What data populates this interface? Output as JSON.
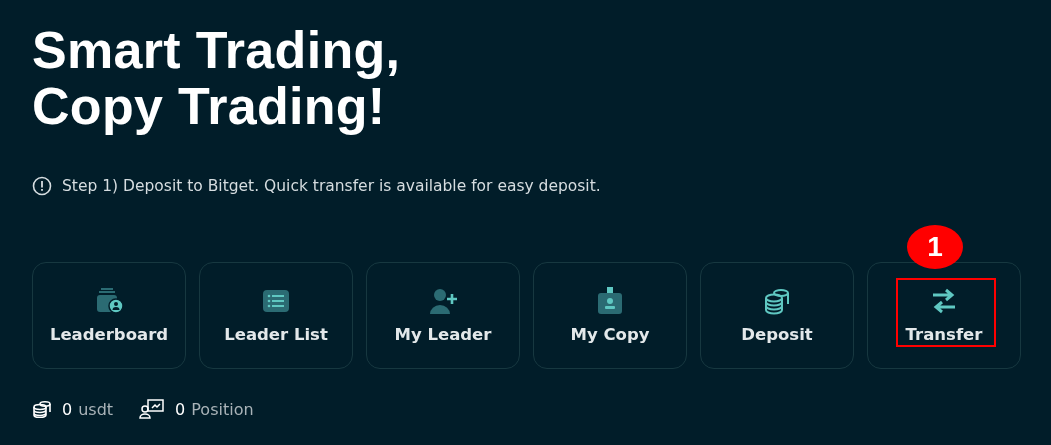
{
  "title_lines": [
    "Smart Trading,",
    "Copy Trading!"
  ],
  "notice": "Step 1) Deposit to Bitget. Quick transfer is available for easy deposit.",
  "actions": [
    {
      "label": "Leaderboard",
      "highlighted": false
    },
    {
      "label": "Leader List",
      "highlighted": false
    },
    {
      "label": "My Leader",
      "highlighted": false
    },
    {
      "label": "My Copy",
      "highlighted": false
    },
    {
      "label": "Deposit",
      "highlighted": false
    },
    {
      "label": "Transfer",
      "highlighted": true,
      "annotation": "1"
    }
  ],
  "stats": [
    {
      "value": "0",
      "unit": "usdt"
    },
    {
      "value": "0",
      "unit": "Position"
    }
  ]
}
